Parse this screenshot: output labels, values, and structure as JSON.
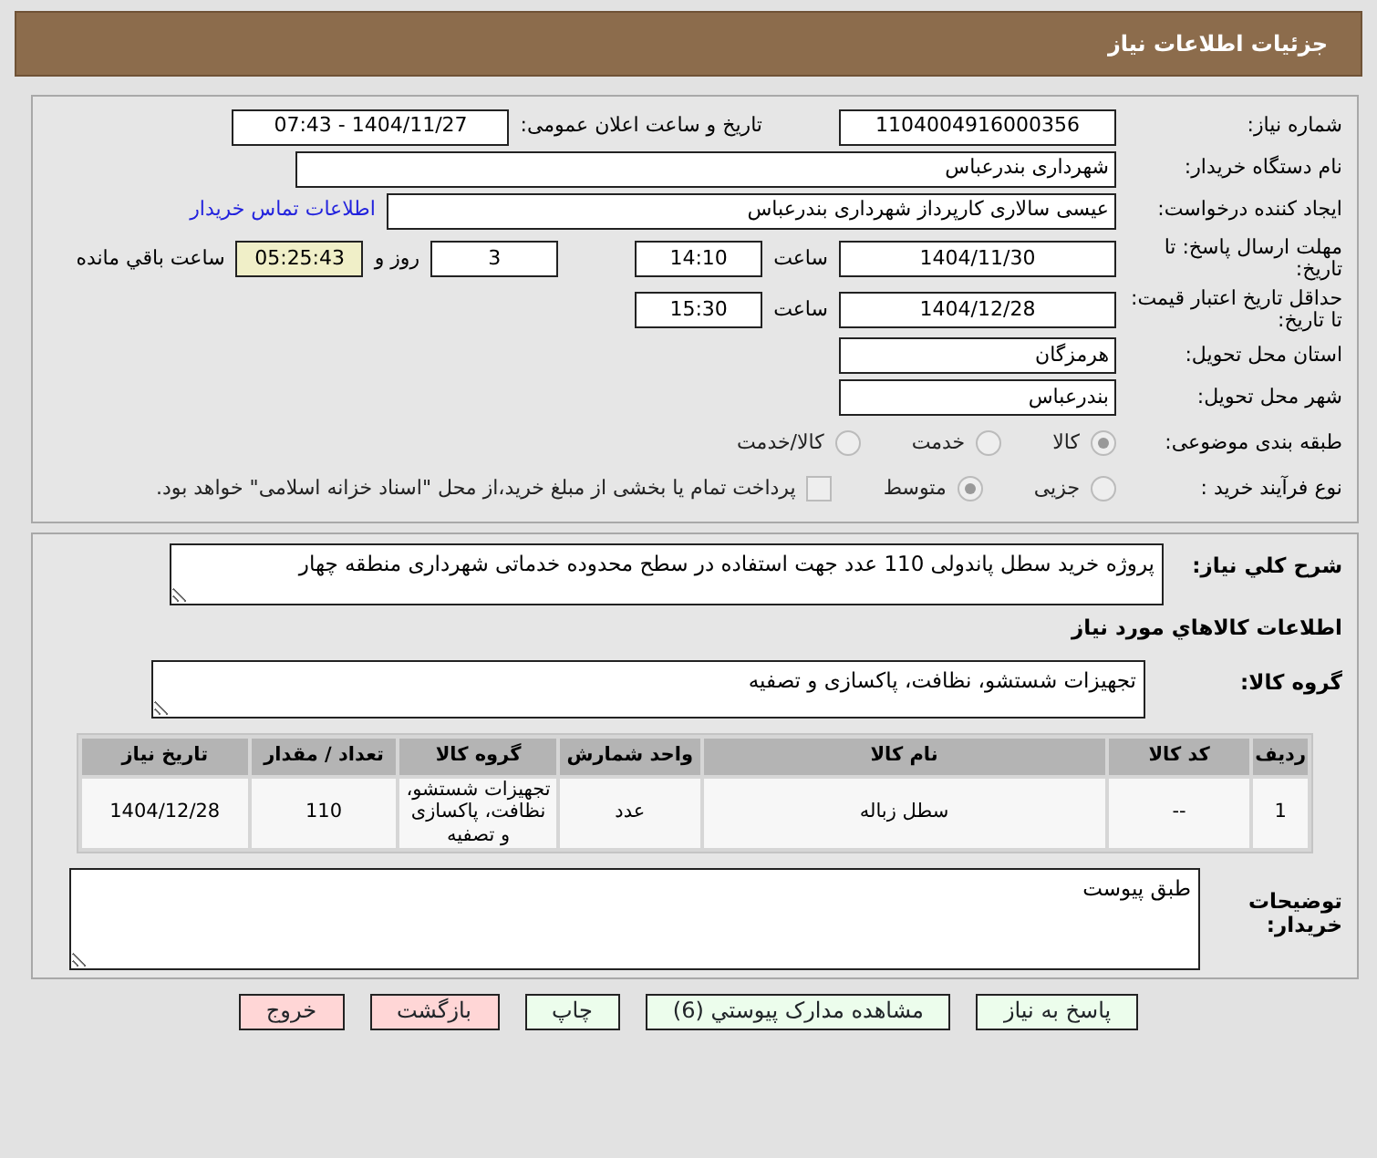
{
  "header": {
    "title": "جزئیات اطلاعات نیاز"
  },
  "need_number": {
    "label": "شماره نیاز:",
    "value": "1104004916000356"
  },
  "announce": {
    "label": "تاریخ و ساعت اعلان عمومی:",
    "value": "1404/11/27 - 07:43"
  },
  "buyer": {
    "label": "نام دستگاه خریدار:",
    "value": "شهرداری بندرعباس"
  },
  "requester": {
    "label": "ایجاد کننده درخواست:",
    "value": "عیسی سالاری کارپرداز شهرداری بندرعباس",
    "link": "اطلاعات تماس خریدار"
  },
  "deadline": {
    "label": "مهلت ارسال پاسخ: تا تاریخ:",
    "date": "1404/11/30",
    "time_label": "ساعت",
    "time": "14:10",
    "days": "3",
    "days_label": "روز و",
    "remaining": "05:25:43",
    "remaining_label": "ساعت باقي مانده"
  },
  "validity": {
    "label": "حداقل تاریخ اعتبار قیمت: تا تاریخ:",
    "date": "1404/12/28",
    "time_label": "ساعت",
    "time": "15:30"
  },
  "province": {
    "label": "استان محل تحویل:",
    "value": "هرمزگان"
  },
  "city": {
    "label": "شهر محل تحویل:",
    "value": "بندرعباس"
  },
  "category": {
    "label": "طبقه بندی موضوعی:",
    "options": [
      {
        "label": "کالا",
        "selected": true
      },
      {
        "label": "خدمت",
        "selected": false
      },
      {
        "label": "کالا/خدمت",
        "selected": false
      }
    ]
  },
  "process": {
    "label": "نوع فرآیند خرید :",
    "options": [
      {
        "label": "جزیی",
        "selected": false
      },
      {
        "label": "متوسط",
        "selected": true
      }
    ],
    "payment": {
      "checked": false,
      "text": "پرداخت تمام یا بخشی از مبلغ خرید،از محل \"اسناد خزانه اسلامی\" خواهد بود."
    }
  },
  "description": {
    "label": "شرح کلي نياز:",
    "value": "پروژه خرید سطل پاندولی 110 عدد جهت استفاده در سطح محدوده خدماتی شهرداری منطقه چهار"
  },
  "goods_title": "اطلاعات کالاهاي مورد نياز",
  "goods_group": {
    "label": "گروه کالا:",
    "value": "تجهیزات شستشو، نظافت، پاکسازی و تصفیه"
  },
  "table": {
    "columns": [
      "ردیف",
      "کد کالا",
      "نام کالا",
      "واحد شمارش",
      "گروه کالا",
      "تعداد / مقدار",
      "تاریخ نیاز"
    ],
    "rows": [
      [
        "1",
        "--",
        "سطل زباله",
        "عدد",
        "تجهیزات شستشو، نظافت، پاکسازی و تصفیه",
        "110",
        "1404/12/28"
      ]
    ]
  },
  "notes": {
    "label": "توضیحات خریدار:",
    "value": "طبق پیوست"
  },
  "buttons": [
    {
      "label": "پاسخ به نیاز",
      "kind": "green"
    },
    {
      "label": "مشاهده مدارک پیوستي (6)",
      "kind": "green"
    },
    {
      "label": "چاپ",
      "kind": "green"
    },
    {
      "label": "بازگشت",
      "kind": "red"
    },
    {
      "label": "خروج",
      "kind": "red"
    }
  ]
}
